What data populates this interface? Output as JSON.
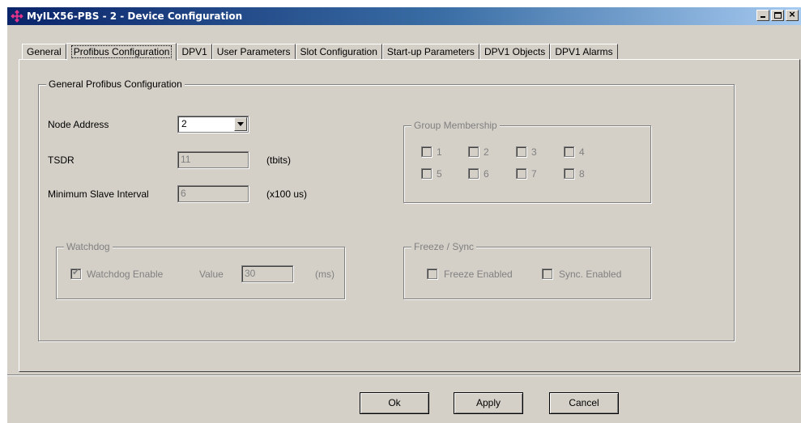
{
  "window": {
    "title": "MyILX56-PBS - 2 - Device Configuration",
    "titlebar_color": "#0a246a"
  },
  "tabs": [
    {
      "label": "General"
    },
    {
      "label": "Profibus Configuration",
      "active": true
    },
    {
      "label": "DPV1"
    },
    {
      "label": "User Parameters"
    },
    {
      "label": "Slot Configuration"
    },
    {
      "label": "Start-up Parameters"
    },
    {
      "label": "DPV1 Objects"
    },
    {
      "label": "DPV1 Alarms"
    }
  ],
  "general_group": {
    "title": "General Profibus Configuration",
    "node_address": {
      "label": "Node Address",
      "value": "2"
    },
    "tsdr": {
      "label": "TSDR",
      "value": "11",
      "unit": "(tbits)"
    },
    "min_slave_interval": {
      "label": "Minimum Slave Interval",
      "value": "6",
      "unit": "(x100 us)"
    }
  },
  "group_membership": {
    "title": "Group Membership",
    "items": [
      "1",
      "2",
      "3",
      "4",
      "5",
      "6",
      "7",
      "8"
    ]
  },
  "watchdog": {
    "title": "Watchdog",
    "enable_label": "Watchdog Enable",
    "enable_checked": true,
    "value_label": "Value",
    "value": "30",
    "unit": "(ms)"
  },
  "freeze_sync": {
    "title": "Freeze / Sync",
    "freeze_label": "Freeze Enabled",
    "sync_label": "Sync. Enabled"
  },
  "buttons": {
    "ok": "Ok",
    "apply": "Apply",
    "cancel": "Cancel"
  }
}
